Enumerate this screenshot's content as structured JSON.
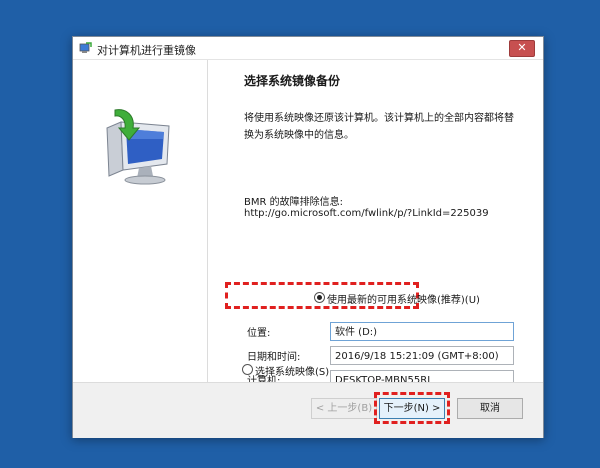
{
  "window": {
    "title": "对计算机进行重镜像",
    "close_glyph": "✕"
  },
  "main": {
    "heading": "选择系统镜像备份",
    "description": "将使用系统映像还原该计算机。该计算机上的全部内容都将替换为系统映像中的信息。",
    "bmr_label": "BMR 的故障排除信息:",
    "bmr_link": "http://go.microsoft.com/fwlink/p/?LinkId=225039"
  },
  "options": {
    "latest_label": "使用最新的可用系统映像(推荐)(U)",
    "latest_selected": true,
    "select_label": "选择系统映像(S)",
    "select_selected": false
  },
  "details": {
    "location_label": "位置:",
    "location_value": "软件 (D:)",
    "datetime_label": "日期和时间:",
    "datetime_value": "2016/9/18 15:21:09 (GMT+8:00)",
    "computer_label": "计算机:",
    "computer_value": "DESKTOP-MBN55RL"
  },
  "footer": {
    "back_label": "< 上一步(B)",
    "next_label": "下一步(N) >",
    "cancel_label": "取消"
  },
  "colors": {
    "desktop": "#1f5fa7",
    "highlight": "#e0201f",
    "close_button": "#c75050",
    "primary_border": "#3c7fb1"
  }
}
